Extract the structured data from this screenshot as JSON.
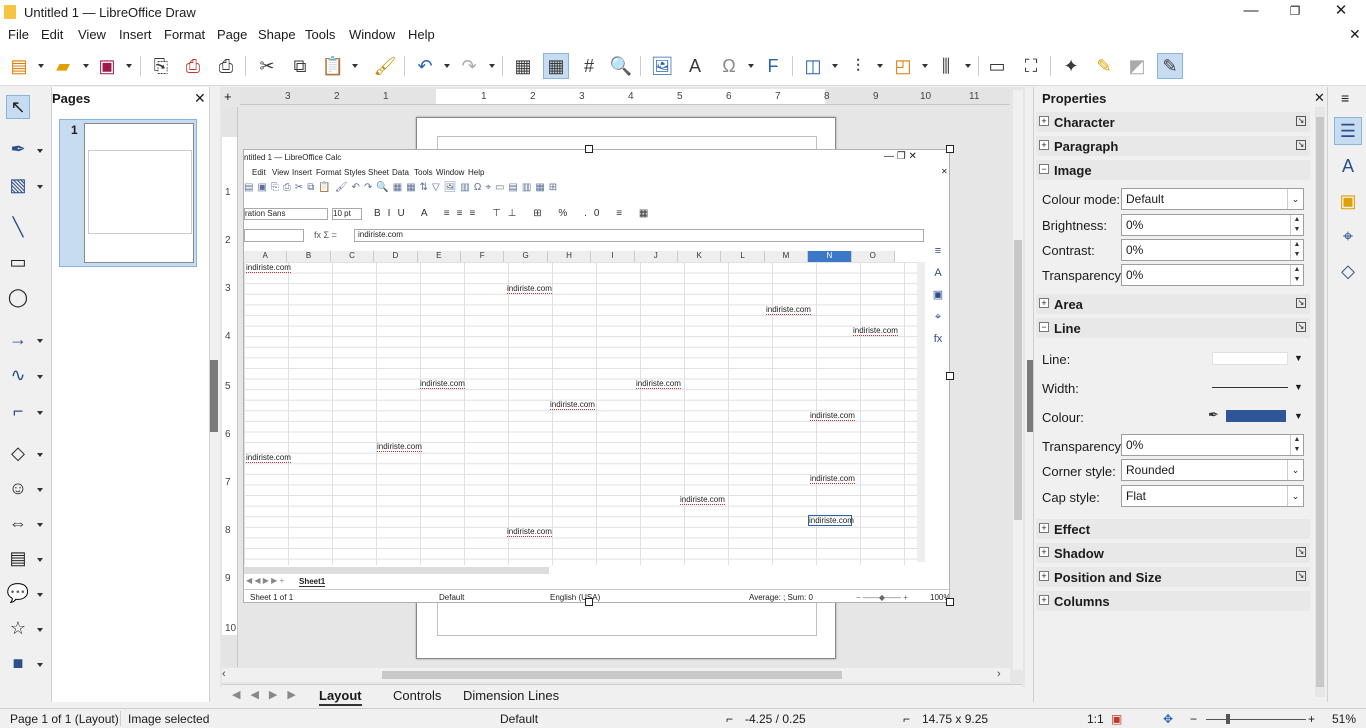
{
  "window": {
    "title": "Untitled 1 — LibreOffice Draw"
  },
  "menu": [
    "File",
    "Edit",
    "View",
    "Insert",
    "Format",
    "Page",
    "Shape",
    "Tools",
    "Window",
    "Help"
  ],
  "pages_panel": {
    "title": "Pages",
    "page_number": "1"
  },
  "ruler": {
    "h_labels": [
      "3",
      "2",
      "1",
      "1",
      "2",
      "3",
      "4",
      "5",
      "6",
      "7",
      "8",
      "9",
      "10",
      "11"
    ],
    "v_labels": [
      "1",
      "2",
      "3",
      "4",
      "5",
      "6",
      "7",
      "8",
      "9",
      "10"
    ]
  },
  "bottom_tabs": [
    "Layout",
    "Controls",
    "Dimension Lines"
  ],
  "properties": {
    "title": "Properties",
    "sections": {
      "character": "Character",
      "paragraph": "Paragraph",
      "image": "Image",
      "area": "Area",
      "line": "Line",
      "effect": "Effect",
      "shadow": "Shadow",
      "position_size": "Position and Size",
      "columns": "Columns"
    },
    "image": {
      "colour_mode_label": "Colour mode:",
      "colour_mode_value": "Default",
      "brightness_label": "Brightness:",
      "brightness_value": "0%",
      "contrast_label": "Contrast:",
      "contrast_value": "0%",
      "transparency_label": "Transparency:",
      "transparency_value": "0%"
    },
    "line": {
      "line_label": "Line:",
      "width_label": "Width:",
      "colour_label": "Colour:",
      "colour_value": "#2f5597",
      "transparency_label": "Transparency:",
      "transparency_value": "0%",
      "corner_label": "Corner style:",
      "corner_value": "Rounded",
      "cap_label": "Cap style:",
      "cap_value": "Flat"
    }
  },
  "status": {
    "page": "Page 1 of 1 (Layout)",
    "selection": "Image selected",
    "style": "Default",
    "position": "-4.25 / 0.25",
    "size": "14.75 x 9.25",
    "scale": "1:1",
    "zoom": "51%"
  },
  "embedded_calc": {
    "title": "ntitled 1 — LibreOffice Calc",
    "menu": [
      "Edit",
      "View",
      "Insert",
      "Format",
      "Styles",
      "Sheet",
      "Data",
      "Tools",
      "Window",
      "Help"
    ],
    "font_name": "ration Sans",
    "font_size": "10 pt",
    "formula_value": "indiriste.com",
    "columns": [
      "A",
      "B",
      "C",
      "D",
      "E",
      "F",
      "G",
      "H",
      "I",
      "J",
      "K",
      "L",
      "M",
      "N",
      "O"
    ],
    "cell_text": "indiriste.com",
    "sheet_tab": "Sheet1",
    "status_sheet": "Sheet 1 of 1",
    "status_style": "Default",
    "status_lang": "English (USA)",
    "status_sum": "Average: ; Sum: 0",
    "status_zoom": "100%"
  }
}
